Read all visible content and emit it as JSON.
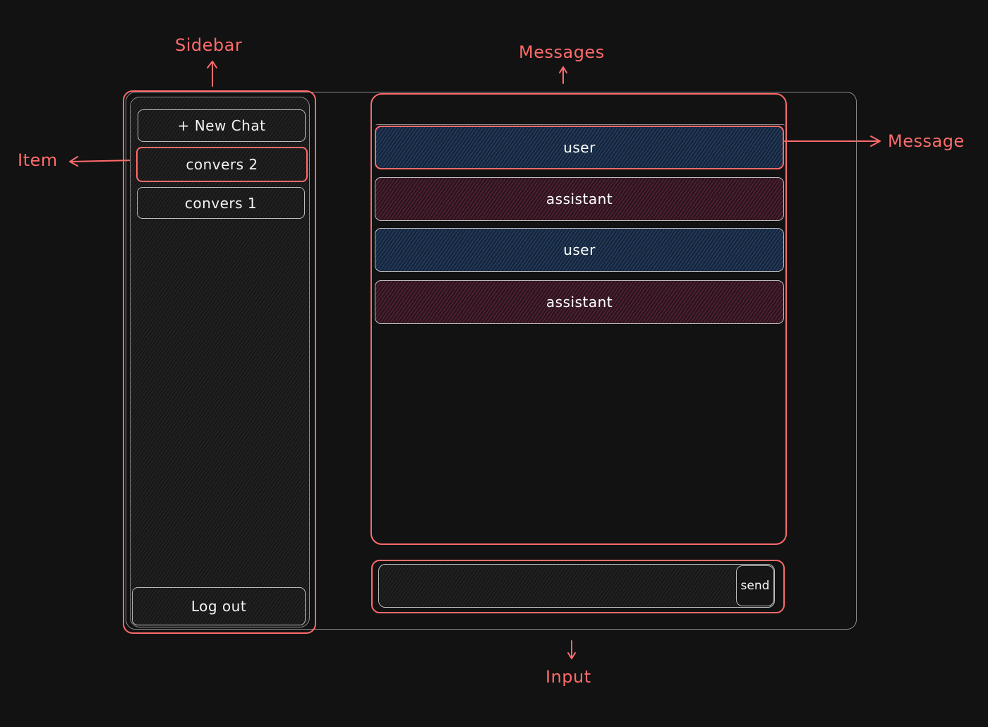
{
  "annotations": {
    "sidebar": "Sidebar",
    "messages": "Messages",
    "item": "Item",
    "message": "Message",
    "input": "Input"
  },
  "sidebar": {
    "new_chat_label": "+ New Chat",
    "items": [
      {
        "label": "convers 2",
        "highlighted": true
      },
      {
        "label": "convers 1",
        "highlighted": false
      }
    ],
    "logout_label": "Log out"
  },
  "messages": [
    {
      "role": "user",
      "label": "user",
      "color": "#1e3a5f"
    },
    {
      "role": "assistant",
      "label": "assistant",
      "color": "#5a1f33"
    },
    {
      "role": "user",
      "label": "user",
      "color": "#1e3a5f"
    },
    {
      "role": "assistant",
      "label": "assistant",
      "color": "#5a1f33"
    }
  ],
  "input": {
    "value": "",
    "send_label": "send"
  },
  "colors": {
    "background": "#121212",
    "annotation": "#ff6b6b",
    "outline": "#bdbdbd"
  }
}
